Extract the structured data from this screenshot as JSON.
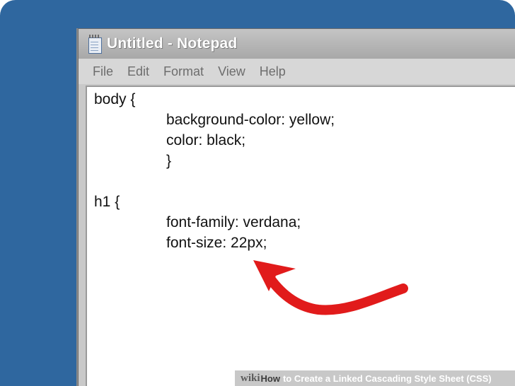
{
  "window": {
    "title": "Untitled - Notepad"
  },
  "menu": {
    "items": [
      "File",
      "Edit",
      "Format",
      "View",
      "Help"
    ]
  },
  "editor": {
    "lines": [
      "body {",
      "background-color: yellow;",
      "color: black;",
      "}",
      "h1 {",
      "font-family: verdana;",
      "font-size: 22px;"
    ]
  },
  "banner": {
    "wiki": "wiki",
    "how": "How",
    "text": "to Create a Linked Cascading Style Sheet (CSS)"
  },
  "colors": {
    "desktop": "#2f679f",
    "arrow": "#e11b1b"
  }
}
